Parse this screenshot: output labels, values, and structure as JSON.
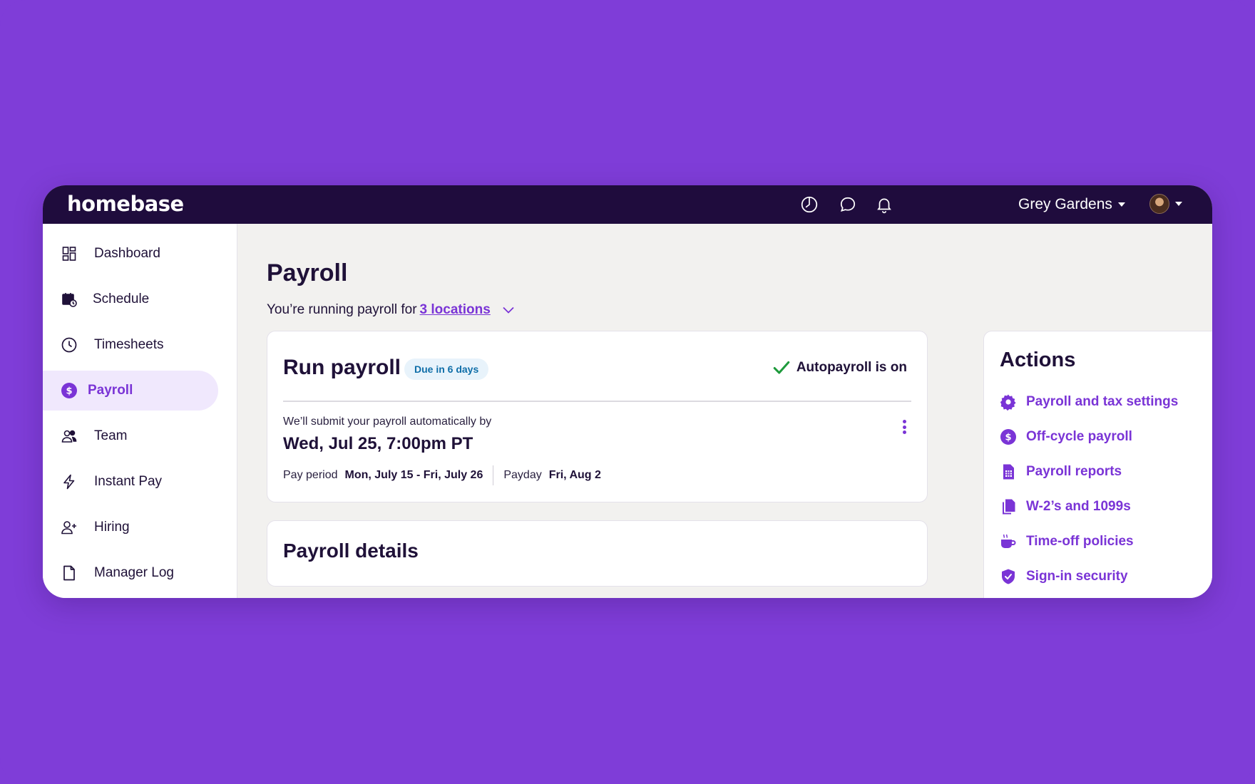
{
  "app": {
    "logo": "homebase",
    "location": "Grey Gardens",
    "topbar_icons": [
      "clock-icon",
      "chat-icon",
      "bell-icon"
    ],
    "accent_color": "#7a34d6",
    "topbar_color": "#1f0c3d",
    "background_color": "#7f3dd8"
  },
  "sidebar": {
    "items": [
      {
        "label": "Dashboard",
        "icon": "dashboard-icon"
      },
      {
        "label": "Schedule",
        "icon": "calendar-clock-icon"
      },
      {
        "label": "Timesheets",
        "icon": "clock-icon"
      },
      {
        "label": "Payroll",
        "icon": "dollar-icon",
        "active": true
      },
      {
        "label": "Team",
        "icon": "team-icon"
      },
      {
        "label": "Instant Pay",
        "icon": "lightning-icon"
      },
      {
        "label": "Hiring",
        "icon": "add-user-icon"
      },
      {
        "label": "Manager Log",
        "icon": "document-icon"
      }
    ]
  },
  "main": {
    "title": "Payroll",
    "running_prefix": "You’re running payroll for",
    "locations_link": "3 locations",
    "run_card": {
      "title": "Run payroll",
      "badge": "Due in 6 days",
      "autopay": "Autopayroll is on",
      "submit_text": "We’ll submit your payroll automatically by",
      "submit_date": "Wed, Jul 25, 7:00pm PT",
      "pay_period_label": "Pay period",
      "pay_period_value": "Mon, July 15 - Fri, July 26",
      "payday_label": "Payday",
      "payday_value": "Fri, Aug 2"
    },
    "details_card": {
      "title": "Payroll details"
    },
    "actions": {
      "title": "Actions",
      "items": [
        {
          "label": "Payroll and tax settings",
          "icon": "gear-icon"
        },
        {
          "label": "Off-cycle payroll",
          "icon": "dollar-icon"
        },
        {
          "label": "Payroll reports",
          "icon": "report-icon"
        },
        {
          "label": "W-2’s and 1099s",
          "icon": "documents-icon"
        },
        {
          "label": "Time-off policies",
          "icon": "coffee-icon"
        },
        {
          "label": "Sign-in security",
          "icon": "shield-icon"
        }
      ]
    }
  }
}
